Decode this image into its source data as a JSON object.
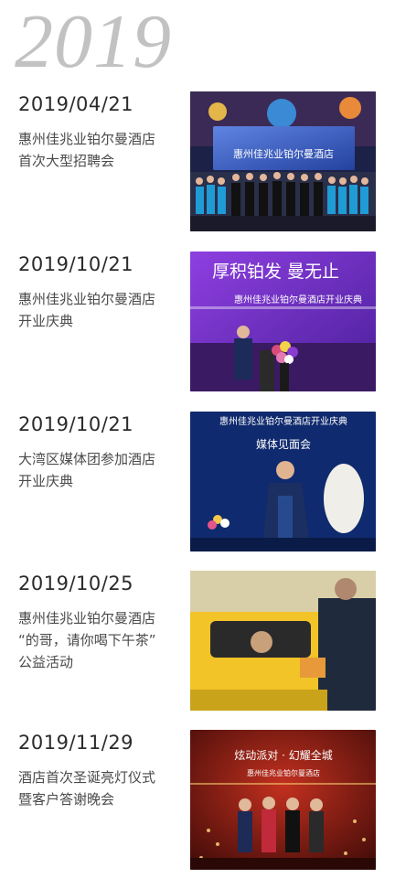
{
  "year": "2019",
  "entries": [
    {
      "date": "2019/04/21",
      "lines": [
        "惠州佳兆业铂尔曼酒店",
        "首次大型招聘会"
      ],
      "photo": {
        "caption": "惠州佳兆业铂尔曼酒店",
        "subcaption": "",
        "bg": "#2a3a8a"
      }
    },
    {
      "date": "2019/10/21",
      "lines": [
        "惠州佳兆业铂尔曼酒店",
        "开业庆典"
      ],
      "photo": {
        "caption": "厚积铂发 曼无止",
        "subcaption": "惠州佳兆业铂尔曼酒店开业庆典",
        "bg": "#6a2fbf"
      }
    },
    {
      "date": "2019/10/21",
      "lines": [
        "大湾区媒体团参加酒店",
        "开业庆典"
      ],
      "photo": {
        "caption": "惠州佳兆业铂尔曼酒店开业庆典",
        "subcaption": "媒体见面会",
        "bg": "#12307a"
      }
    },
    {
      "date": "2019/10/25",
      "lines": [
        "惠州佳兆业铂尔曼酒店",
        "“的哥，请你喝下午茶”",
        "公益活动"
      ],
      "photo": {
        "caption": "",
        "subcaption": "",
        "bg": "#d9c07a"
      }
    },
    {
      "date": "2019/11/29",
      "lines": [
        "酒店首次圣诞亮灯仪式",
        "暨客户答谢晚会"
      ],
      "photo": {
        "caption": "炫动派对 · 幻耀全城",
        "subcaption": "惠州佳兆业铂尔曼酒店",
        "bg": "#8a1a12"
      }
    }
  ]
}
